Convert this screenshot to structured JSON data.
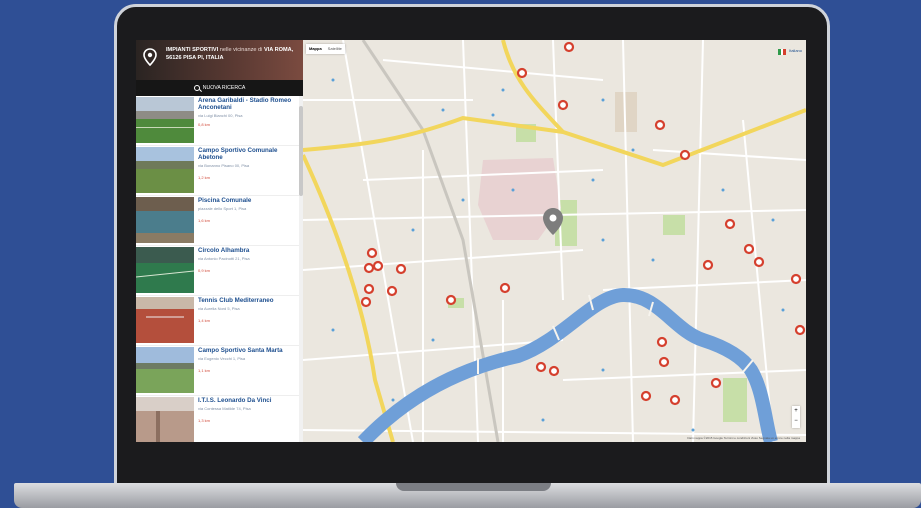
{
  "sidebar": {
    "title_bold": "IMPIANTI SPORTIVI",
    "title_light": "nelle vicinanze di",
    "title_place": "VIA ROMA, 56126 PISA PI, ITALIA",
    "new_search_label": "NUOVA RICERCA",
    "items": [
      {
        "name": "Arena Garibaldi - Stadio Romeo Anconetani",
        "address": "via Luigi Bianchi 00, Pisa",
        "distance": "0,8 km"
      },
      {
        "name": "Campo Sportivo Comunale Abetone",
        "address": "via Bonanno Pisano 00, Pisa",
        "distance": "1,2 km"
      },
      {
        "name": "Piscina Comunale",
        "address": "piazzale dello Sport 1, Pisa",
        "distance": "1,6 km"
      },
      {
        "name": "Circolo Alhambra",
        "address": "via Antonio Pacinotti 21, Pisa",
        "distance": "0,9 km"
      },
      {
        "name": "Tennis Club Mediterraneo",
        "address": "via Aurelia Nord 5, Pisa",
        "distance": "1,4 km"
      },
      {
        "name": "Campo Sportivo Santa Marta",
        "address": "via Eugenio Vecchi 1, Pisa",
        "distance": "1,1 km"
      },
      {
        "name": "I.T.I.S. Leonardo Da Vinci",
        "address": "via Contessa Matilde 74, Pisa",
        "distance": "1,3 km"
      }
    ]
  },
  "map": {
    "toggle": [
      "Mappa",
      "Satellite"
    ],
    "lang": "Italiano",
    "footer": "Dati mappa ©2015 Google  Termini e condizioni d'uso  Segnala un errore nella mappa",
    "zoom_in": "+",
    "zoom_out": "−",
    "colors": {
      "water": "#6f9fd8",
      "road_major": "#f2d65c",
      "land": "#ebe7df",
      "park": "#c7dfa8",
      "marker": "#d5402e"
    },
    "icons": [
      "location-pin-icon",
      "sports-marker-icon",
      "italian-flag-icon",
      "search-icon"
    ]
  }
}
